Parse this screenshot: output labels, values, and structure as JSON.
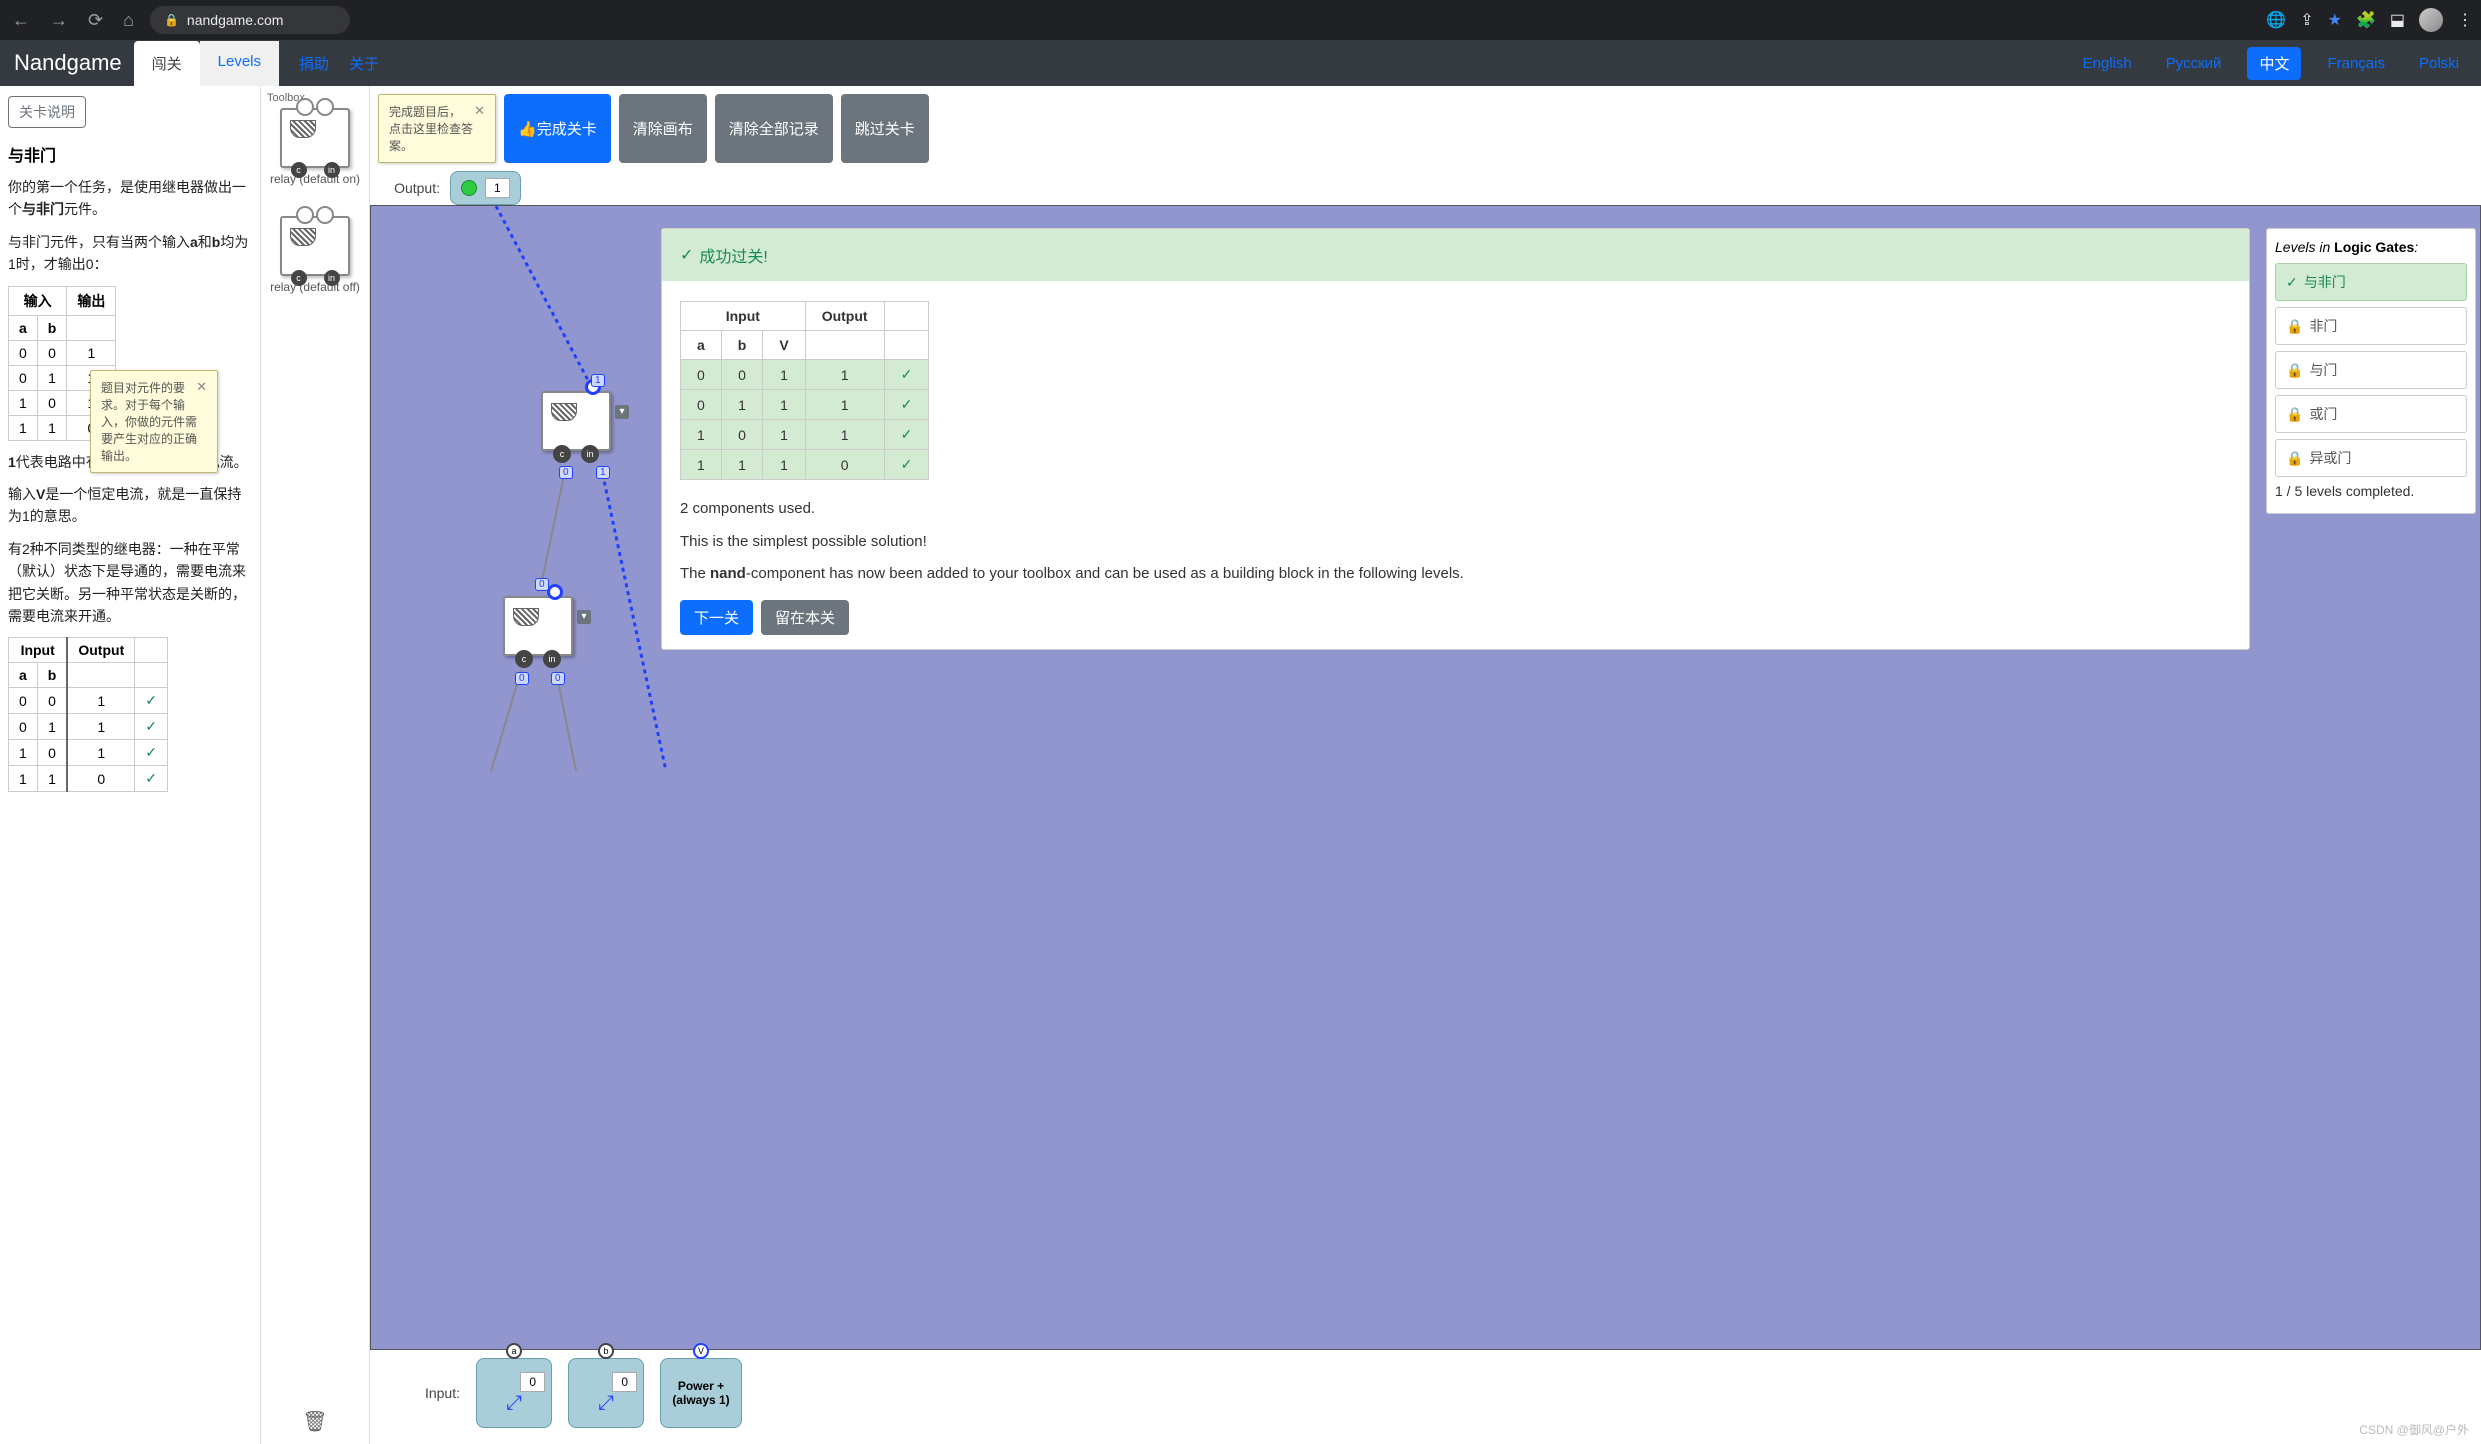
{
  "browser": {
    "url_host": "nandgame.com"
  },
  "nav": {
    "brand": "Nandgame",
    "tab_main": "闯关",
    "tab_levels": "Levels",
    "link_donate": "捐助",
    "link_about": "关于",
    "lang_en": "English",
    "lang_ru": "Русский",
    "lang_zh": "中文",
    "lang_fr": "Français",
    "lang_pl": "Polski"
  },
  "sidebar": {
    "btn_desc": "关卡说明",
    "title": "与非门",
    "p1_a": "你的第一个任务，是使用继电器做出一个",
    "p1_b": "与非门",
    "p1_c": "元件。",
    "p2_a": "与非门元件，只有当两个输入",
    "p2_b": "a",
    "p2_c": "和",
    "p2_d": "b",
    "p2_e": "均为1时，才输出0：",
    "th_input": "输入",
    "th_output": "输出",
    "th_a": "a",
    "th_b": "b",
    "rows": [
      [
        "0",
        "0",
        "1"
      ],
      [
        "0",
        "1",
        "1"
      ],
      [
        "1",
        "0",
        "1"
      ],
      [
        "1",
        "1",
        "0"
      ]
    ],
    "p3_a": "1",
    "p3_b": "代表电路中有电流，",
    "p3_c": "0",
    "p3_d": "代表没有电流。",
    "p4_a": "输入",
    "p4_b": "V",
    "p4_c": "是一个恒定电流，就是一直保持为1的意思。",
    "p5": "有2种不同类型的继电器：一种在平常（默认）状态下是导通的，需要电流来把它关断。另一种平常状态是关断的，需要电流来开通。",
    "tt2": {
      "th_input": "Input",
      "th_output": "Output",
      "th_a": "a",
      "th_b": "b",
      "rows": [
        [
          "0",
          "0",
          "1",
          "✓"
        ],
        [
          "0",
          "1",
          "1",
          "✓"
        ],
        [
          "1",
          "0",
          "1",
          "✓"
        ],
        [
          "1",
          "1",
          "0",
          "✓"
        ]
      ]
    },
    "tooltip_req": "题目对元件的要求。对于每个输入，你做的元件需要产生对应的正确输出。"
  },
  "toolbox": {
    "label": "Toolbox",
    "relay_on": "relay (default on)",
    "relay_off": "relay (default off)",
    "pin_c": "c",
    "pin_in": "in"
  },
  "toolbar": {
    "tooltip_check": "完成题目后，点击这里检查答案。",
    "btn_check": "完成关卡",
    "btn_clear_canvas": "清除画布",
    "btn_clear_all": "清除全部记录",
    "btn_skip": "跳过关卡"
  },
  "io": {
    "output_label": "Output:",
    "output_val": "1",
    "input_label": "Input:",
    "input_a": "a",
    "input_a_val": "0",
    "input_b": "b",
    "input_b_val": "0",
    "power": "Power + (always 1)",
    "v": "V"
  },
  "canvas": {
    "relay_c": "c",
    "relay_in": "in",
    "sig1": "1",
    "sig0": "0"
  },
  "result": {
    "header": "成功过关!",
    "th_input": "Input",
    "th_output": "Output",
    "th_a": "a",
    "th_b": "b",
    "th_V": "V",
    "rows": [
      [
        "0",
        "0",
        "1",
        "1",
        "✓"
      ],
      [
        "0",
        "1",
        "1",
        "1",
        "✓"
      ],
      [
        "1",
        "0",
        "1",
        "1",
        "✓"
      ],
      [
        "1",
        "1",
        "1",
        "0",
        "✓"
      ]
    ],
    "p1": "2 components used.",
    "p2": "This is the simplest possible solution!",
    "p3_a": "The ",
    "p3_b": "nand",
    "p3_c": "-component has now been added to your toolbox and can be used as a building block in the following levels.",
    "btn_next": "下一关",
    "btn_stay": "留在本关"
  },
  "levels": {
    "title_a": "Levels in ",
    "title_b": "Logic Gates",
    "title_c": ":",
    "items": [
      {
        "label": "与非门",
        "done": true
      },
      {
        "label": "非门",
        "done": false
      },
      {
        "label": "与门",
        "done": false
      },
      {
        "label": "或门",
        "done": false
      },
      {
        "label": "异或门",
        "done": false
      }
    ],
    "count": "1 / 5 levels completed."
  },
  "watermark": "CSDN @御风@户外",
  "check_glyph": "✓",
  "thumb_glyph": "👍"
}
